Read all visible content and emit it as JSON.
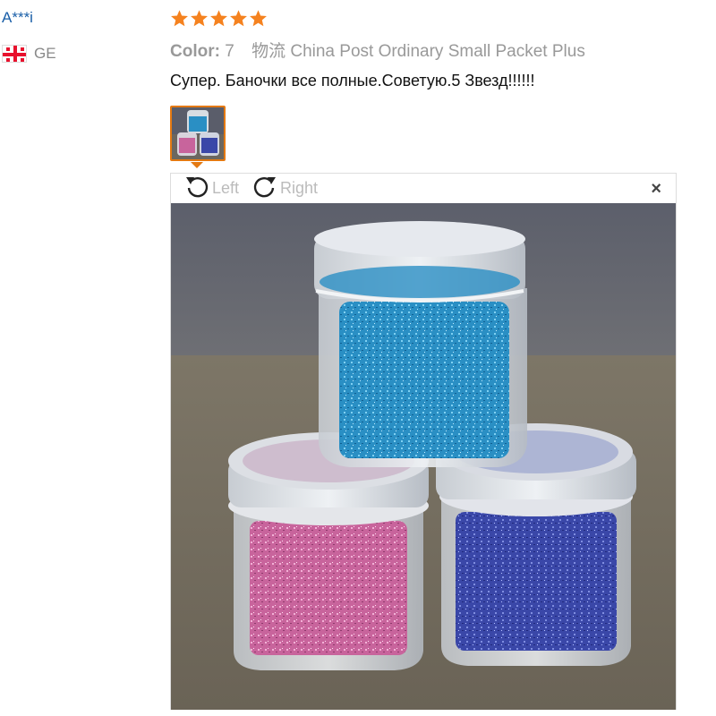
{
  "reviewer": {
    "name": "A***i",
    "country_code": "GE"
  },
  "review": {
    "rating": 5,
    "max_rating": 5,
    "color_label": "Color:",
    "color_value": "7",
    "shipping": "物流 China Post Ordinary Small Packet Plus",
    "text": "Супер. Баночки все полные.Советую.5 Звезд!!!!!!"
  },
  "viewer": {
    "rotate_left_label": "Left",
    "rotate_right_label": "Right",
    "close_symbol": "×"
  },
  "icons": {
    "star": "star-icon",
    "rotate_left": "rotate-left-icon",
    "rotate_right": "rotate-right-icon",
    "close": "close-icon",
    "flag": "georgia-flag-icon"
  },
  "colors": {
    "star": "#f5821f",
    "username": "#1a5fa8",
    "thumbnail_border": "#e47911",
    "glitter_blue": "#2a8fc4",
    "glitter_pink": "#c8649c",
    "glitter_navy": "#3a47a8"
  }
}
